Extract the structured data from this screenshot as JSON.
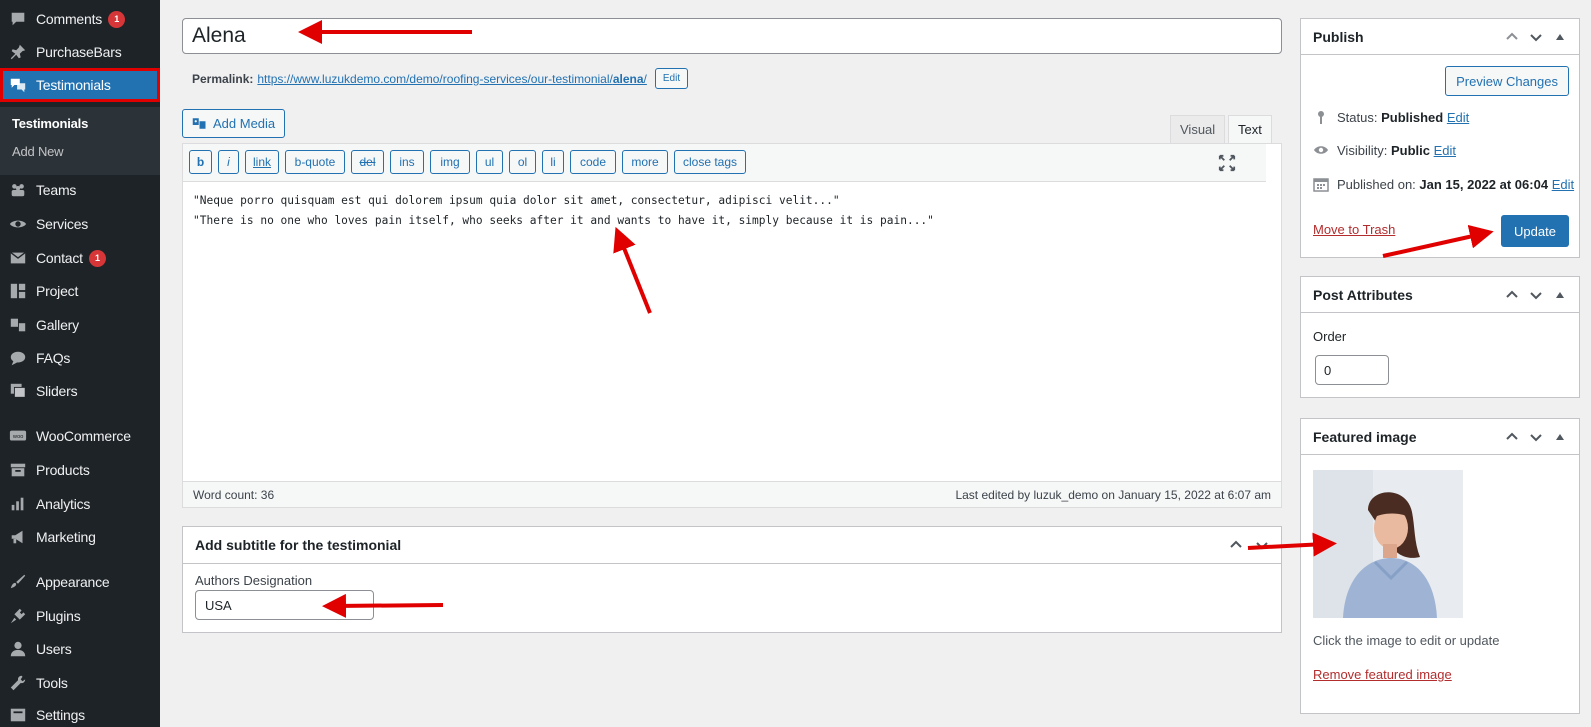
{
  "sidebar": {
    "items": [
      {
        "label": "Comments",
        "icon": "comment-icon",
        "badge": "1"
      },
      {
        "label": "PurchaseBars",
        "icon": "pin-icon"
      },
      {
        "label": "Testimonials",
        "icon": "testimonial-icon"
      },
      {
        "label": "Teams",
        "icon": "groups-icon"
      },
      {
        "label": "Services",
        "icon": "eye-icon"
      },
      {
        "label": "Contact",
        "icon": "email-icon",
        "badge": "1"
      },
      {
        "label": "Project",
        "icon": "grid-icon"
      },
      {
        "label": "Gallery",
        "icon": "media-icon"
      },
      {
        "label": "FAQs",
        "icon": "speech-bubble-icon"
      },
      {
        "label": "Sliders",
        "icon": "images-icon"
      },
      {
        "label": "WooCommerce",
        "icon": "woo-icon"
      },
      {
        "label": "Products",
        "icon": "archive-icon"
      },
      {
        "label": "Analytics",
        "icon": "bar-chart-icon"
      },
      {
        "label": "Marketing",
        "icon": "megaphone-icon"
      },
      {
        "label": "Appearance",
        "icon": "brush-icon"
      },
      {
        "label": "Plugins",
        "icon": "plug-icon"
      },
      {
        "label": "Users",
        "icon": "user-icon"
      },
      {
        "label": "Tools",
        "icon": "wrench-icon"
      },
      {
        "label": "Settings",
        "icon": "settings-icon"
      }
    ],
    "submenu": [
      "Testimonials",
      "Add New"
    ]
  },
  "post": {
    "title": "Alena",
    "permalink_label": "Permalink:",
    "permalink_url": "https://www.luzukdemo.com/demo/roofing-services/our-testimonial/",
    "permalink_slug": "alena",
    "permalink_trail": "/",
    "edit_label": "Edit"
  },
  "editor": {
    "add_media": "Add Media",
    "tab_visual": "Visual",
    "tab_text": "Text",
    "buttons": [
      "b",
      "i",
      "link",
      "b-quote",
      "del",
      "ins",
      "img",
      "ul",
      "ol",
      "li",
      "code",
      "more",
      "close tags"
    ],
    "content_line1": "\"Neque porro quisquam est qui dolorem ipsum quia dolor sit amet, consectetur, adipisci velit...\"",
    "content_line2": "\"There is no one who loves pain itself, who seeks after it and wants to have it, simply because it is pain...\"",
    "word_count": "Word count: 36",
    "last_edited": "Last edited by luzuk_demo on January 15, 2022 at 6:07 am"
  },
  "subtitle_box": {
    "title": "Add subtitle for the testimonial",
    "field_label": "Authors Designation",
    "field_value": "USA"
  },
  "publish": {
    "title": "Publish",
    "preview": "Preview Changes",
    "status_label": "Status:",
    "status_value": "Published",
    "visibility_label": "Visibility:",
    "visibility_value": "Public",
    "published_label": "Published on:",
    "published_value": "Jan 15, 2022 at 06:04",
    "edit": "Edit",
    "trash": "Move to Trash",
    "update": "Update"
  },
  "attributes": {
    "title": "Post Attributes",
    "order_label": "Order",
    "order_value": "0"
  },
  "featured": {
    "title": "Featured image",
    "caption": "Click the image to edit or update",
    "remove": "Remove featured image"
  },
  "colors": {
    "sidebar_bg": "#1d2327",
    "accent": "#2271b1",
    "annotation": "#e00000",
    "danger": "#b32d2e"
  }
}
